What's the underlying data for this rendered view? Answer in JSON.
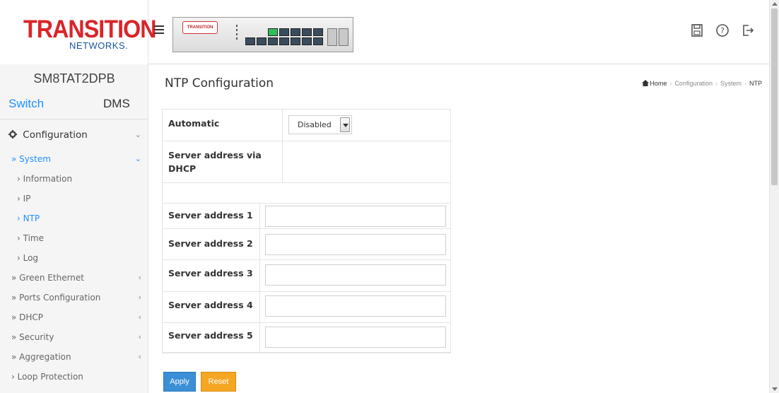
{
  "header": {
    "logo_main": "TRANSITION",
    "logo_sub": "NETWORKS",
    "device_brand": "TRANSITION",
    "icons": [
      "save-icon",
      "help-icon",
      "logout-icon"
    ]
  },
  "sidebar": {
    "model": "SM8TAT2DPB",
    "tabs": {
      "switch": "Switch",
      "dms": "DMS"
    },
    "configuration": {
      "label": "Configuration",
      "caret": "⌄"
    },
    "items": [
      {
        "label": "» System",
        "caret": "⌄",
        "active": true
      },
      {
        "label": "› Information",
        "active": false
      },
      {
        "label": "›  IP",
        "active": false
      },
      {
        "label": "›  NTP",
        "active": true
      },
      {
        "label": "›  Time",
        "active": false
      },
      {
        "label": "›  Log",
        "active": false
      },
      {
        "label": "» Green Ethernet",
        "caret": "‹"
      },
      {
        "label": "» Ports Configuration",
        "caret": "‹"
      },
      {
        "label": "» DHCP",
        "caret": "‹"
      },
      {
        "label": "» Security",
        "caret": "‹"
      },
      {
        "label": "» Aggregation",
        "caret": "‹"
      },
      {
        "label": "› Loop Protection",
        "caret": ""
      }
    ]
  },
  "main": {
    "title": "NTP Configuration",
    "breadcrumb": {
      "home": "Home",
      "configuration": "Configuration",
      "system": "System",
      "current": "NTP"
    },
    "automatic": {
      "label": "Automatic",
      "value": "Disabled"
    },
    "server_dhcp": {
      "label": "Server address via DHCP",
      "value": ""
    },
    "servers": [
      {
        "label": "Server address 1",
        "value": ""
      },
      {
        "label": "Server address 2",
        "value": ""
      },
      {
        "label": "Server address 3",
        "value": ""
      },
      {
        "label": "Server address 4",
        "value": ""
      },
      {
        "label": "Server address 5",
        "value": ""
      }
    ],
    "apply_label": "Apply",
    "reset_label": "Reset"
  },
  "colors": {
    "accent": "#1e90ff",
    "brand_red": "#d9252a",
    "brand_blue": "#17549d",
    "apply_button": "#3b8fd6",
    "reset_button": "#f5a623"
  }
}
